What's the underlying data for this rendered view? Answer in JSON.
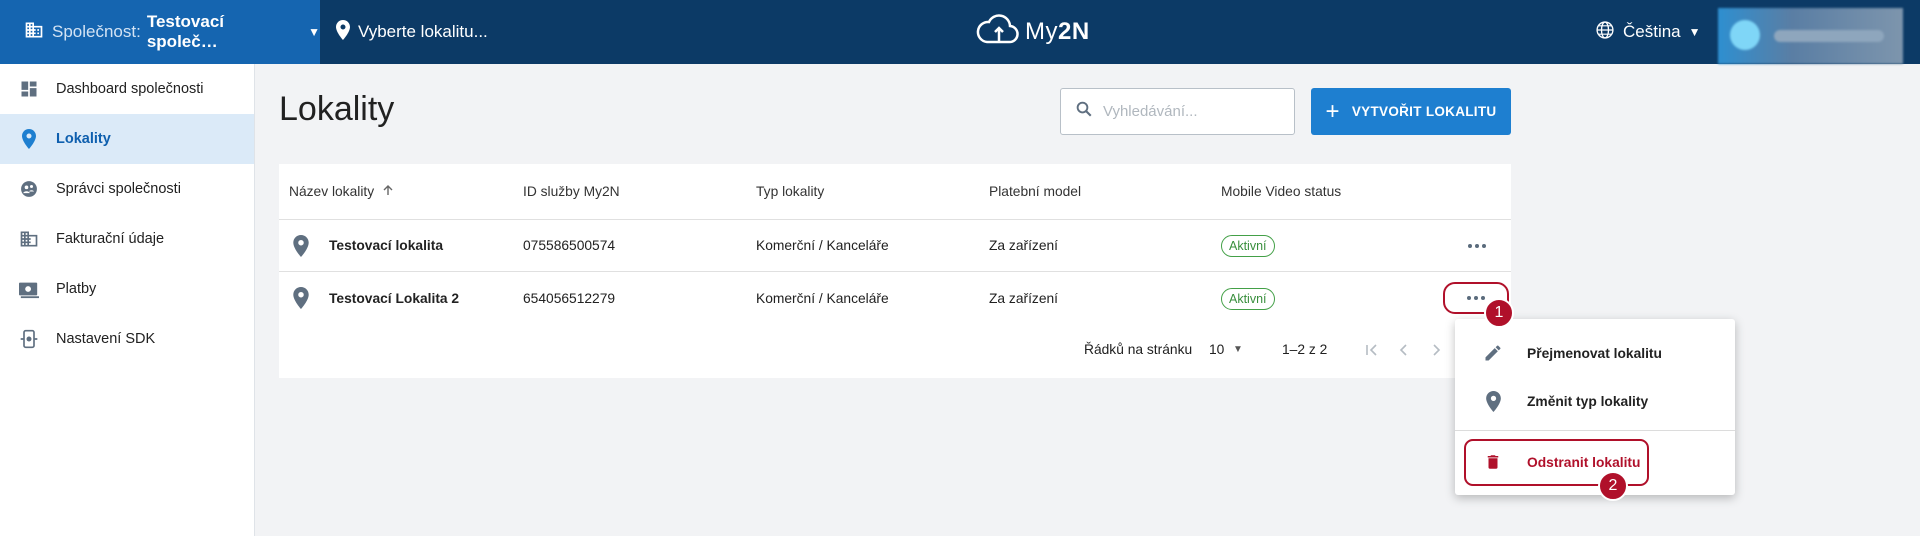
{
  "topbar": {
    "company_label": "Společnost:",
    "company_value": "Testovací společ…",
    "location_placeholder": "Vyberte lokalitu...",
    "logo_text_a": "My",
    "logo_text_b": "2N",
    "language": "Čeština"
  },
  "sidebar": {
    "items": [
      {
        "label": "Dashboard společnosti",
        "icon": "dashboard-icon"
      },
      {
        "label": "Lokality",
        "icon": "location-pin-icon",
        "active": true
      },
      {
        "label": "Správci společnosti",
        "icon": "admins-icon"
      },
      {
        "label": "Fakturační údaje",
        "icon": "building-icon"
      },
      {
        "label": "Platby",
        "icon": "payments-icon"
      },
      {
        "label": "Nastavení SDK",
        "icon": "sdk-icon"
      }
    ]
  },
  "page": {
    "title": "Lokality",
    "search_placeholder": "Vyhledávání...",
    "create_button": "VYTVOŘIT LOKALITU"
  },
  "table": {
    "headers": [
      "Název lokality",
      "ID služby My2N",
      "Typ lokality",
      "Platební model",
      "Mobile Video status"
    ],
    "rows": [
      {
        "name": "Testovací lokalita",
        "id": "075586500574",
        "type": "Komerční / Kanceláře",
        "payment": "Za zařízení",
        "status": "Aktivní"
      },
      {
        "name": "Testovací Lokalita 2",
        "id": "654056512279",
        "type": "Komerční / Kanceláře",
        "payment": "Za zařízení",
        "status": "Aktivní"
      }
    ]
  },
  "pagination": {
    "rows_label": "Řádků na stránku",
    "rows_value": "10",
    "range": "1–2 z 2"
  },
  "menu": {
    "rename": "Přejmenovat lokalitu",
    "change_type": "Změnit typ lokality",
    "delete": "Odstranit lokalitu"
  },
  "callouts": [
    "1",
    "2"
  ],
  "colors": {
    "topbar": "#0c3a66",
    "company_block": "#1565b0",
    "accent": "#1e7fd0",
    "danger": "#b0102a",
    "active_nav_bg": "#dbeaf8",
    "status_green": "#388e3c"
  }
}
